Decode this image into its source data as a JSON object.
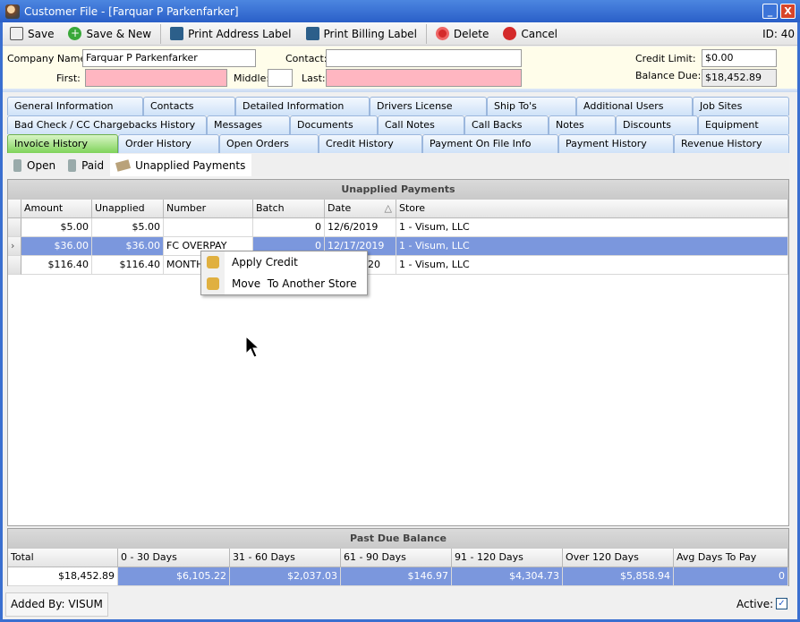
{
  "window": {
    "title": "Customer File - [Farquar P Parkenfarker]",
    "minimize": "_",
    "close": "X"
  },
  "toolbar": {
    "save": "Save",
    "save_new": "Save & New",
    "print_address": "Print Address Label",
    "print_billing": "Print Billing Label",
    "delete": "Delete",
    "cancel": "Cancel",
    "id": "ID: 40"
  },
  "form": {
    "company_label": "Company Name:",
    "company": "Farquar P Parkenfarker",
    "contact_label": "Contact:",
    "contact": "",
    "first_label": "First:",
    "first": "",
    "middle_label": "Middle:",
    "middle": "",
    "last_label": "Last:",
    "last": "",
    "credit_limit_label": "Credit Limit:",
    "credit_limit": "$0.00",
    "balance_due_label": "Balance Due:",
    "balance_due": "$18,452.89"
  },
  "tabs": {
    "row1": [
      "General Information",
      "Contacts",
      "Detailed Information",
      "Drivers License",
      "Ship To's",
      "Additional Users",
      "Job Sites"
    ],
    "row2": [
      "Bad Check / CC Chargebacks History",
      "Messages",
      "Documents",
      "Call Notes",
      "Call Backs",
      "Notes",
      "Discounts",
      "Equipment"
    ],
    "row3": [
      "Invoice History",
      "Order History",
      "Open Orders",
      "Credit History",
      "Payment On File Info",
      "Payment History",
      "Revenue History"
    ],
    "active": "Invoice History"
  },
  "subtabs": {
    "open": "Open",
    "paid": "Paid",
    "unapplied": "Unapplied Payments",
    "active": "Unapplied Payments"
  },
  "grid": {
    "caption": "Unapplied Payments",
    "columns": [
      "Amount",
      "Unapplied",
      "Number",
      "Batch",
      "Date",
      "Store"
    ],
    "sort_indicator": "△",
    "rows": [
      [
        "$5.00",
        "$5.00",
        "",
        "0",
        "12/6/2019",
        "1 - Visum, LLC"
      ],
      [
        "$36.00",
        "$36.00",
        "FC OVERPAY",
        "0",
        "12/17/2019",
        "1 - Visum, LLC"
      ],
      [
        "$116.40",
        "$116.40",
        "MONTH",
        "",
        "20",
        "1 - Visum, LLC"
      ]
    ],
    "selected_row": 1,
    "row_indicator": "›"
  },
  "context_menu": {
    "items": [
      "Apply Credit",
      "Move  To Another Store"
    ]
  },
  "past_due": {
    "caption": "Past Due Balance",
    "columns": [
      "Total",
      "0 - 30 Days",
      "31 - 60 Days",
      "61 - 90 Days",
      "91 - 120 Days",
      "Over 120 Days",
      "Avg Days To Pay"
    ],
    "values": [
      "$18,452.89",
      "$6,105.22",
      "$2,037.03",
      "$146.97",
      "$4,304.73",
      "$5,858.94",
      "0"
    ]
  },
  "footer": {
    "added_by": "Added By: VISUM",
    "active_label": "Active:",
    "active": true,
    "check": "✓"
  },
  "colors": {
    "selection": "#7b97dd",
    "required": "#ffb6c1",
    "title_bar": "#2a5fc8",
    "active_tab": "#7fd35a"
  }
}
